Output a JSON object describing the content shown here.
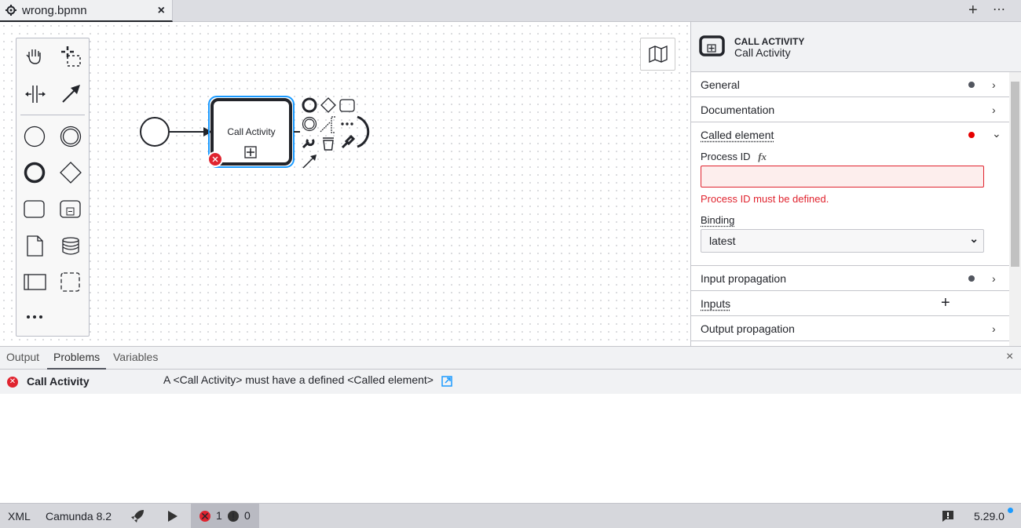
{
  "tabbar": {
    "tab_title": "wrong.bpmn",
    "tab_icon": "gear-icon",
    "close": "×",
    "add": "+",
    "more": "⋯"
  },
  "diagram": {
    "task_label": "Call Activity",
    "marker": "⊞"
  },
  "properties": {
    "element_type": "CALL ACTIVITY",
    "element_name": "Call Activity",
    "groups": [
      {
        "label": "General"
      },
      {
        "label": "Documentation"
      },
      {
        "label": "Called element"
      },
      {
        "label": "Input propagation"
      },
      {
        "label": "Inputs"
      },
      {
        "label": "Output propagation"
      }
    ],
    "process_id_label": "Process ID",
    "fx": "fx",
    "process_id_value": "",
    "process_id_error": "Process ID must be defined.",
    "binding_label": "Binding",
    "binding_value": "latest",
    "inputs_add": "+",
    "colors": {
      "error": "#e0242f",
      "accent": "#1a9aff"
    }
  },
  "bottom": {
    "tabs": [
      "Output",
      "Problems",
      "Variables"
    ],
    "active_tab": "Problems",
    "close": "×",
    "problems": [
      {
        "element": "Call Activity",
        "message": "A <Call Activity> must have a defined <Called element>"
      }
    ]
  },
  "status": {
    "xml": "XML",
    "platform": "Camunda 8.2",
    "errors": "1",
    "warnings": "0",
    "version": "5.29.0"
  }
}
